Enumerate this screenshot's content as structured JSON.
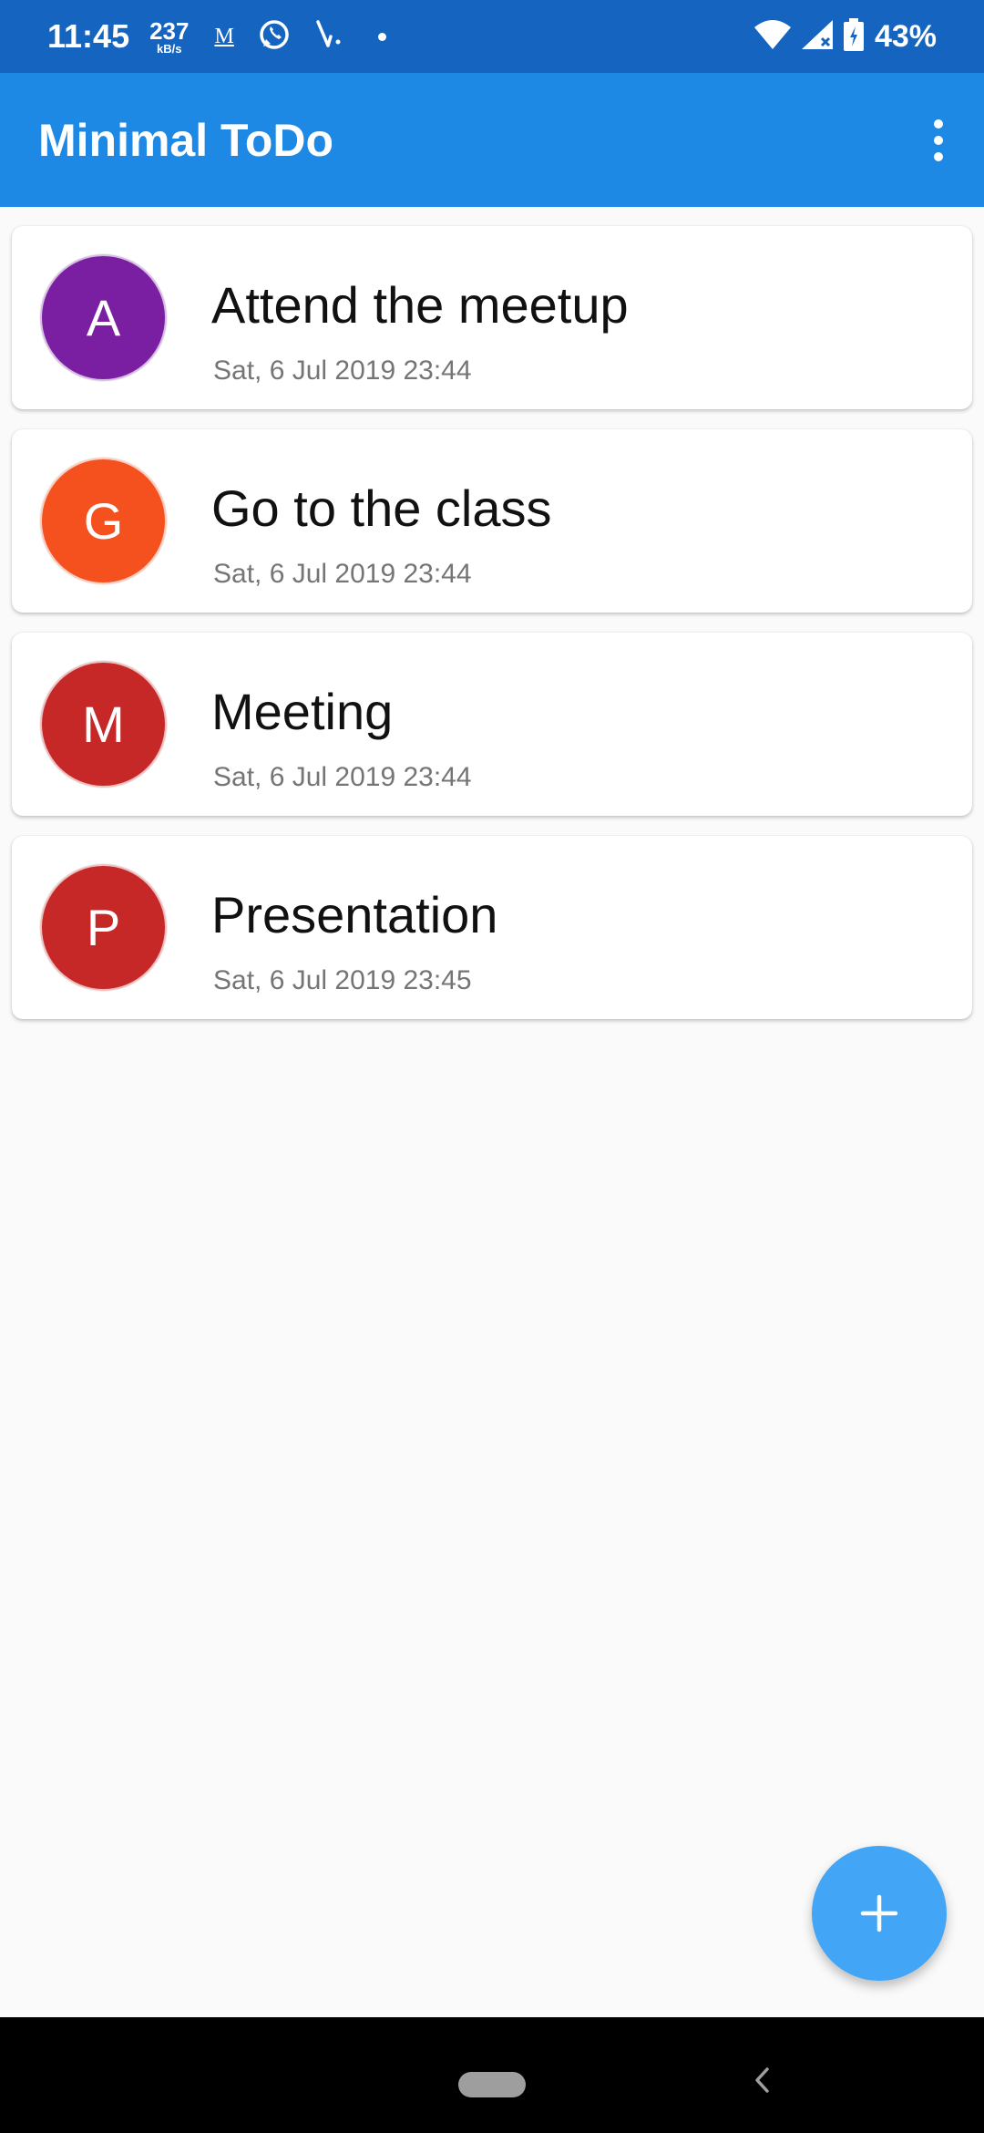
{
  "status_bar": {
    "time": "11:45",
    "net_speed_value": "237",
    "net_speed_unit": "kB/s",
    "gmail_icon": "M",
    "battery_percent": "43%",
    "icons": [
      "gmail-icon",
      "whatsapp-icon",
      "vpn-icon",
      "notification-dot-icon",
      "wifi-icon",
      "signal-icon",
      "battery-icon"
    ]
  },
  "app_bar": {
    "title": "Minimal ToDo",
    "menu_icon": "more-vert-icon",
    "color": "#1e88e5"
  },
  "todos": [
    {
      "letter": "A",
      "title": "Attend the meetup",
      "date": "Sat, 6 Jul 2019 23:44",
      "color": "#7b1fa2"
    },
    {
      "letter": "G",
      "title": "Go to the class",
      "date": "Sat, 6 Jul 2019 23:44",
      "color": "#f4511e"
    },
    {
      "letter": "M",
      "title": "Meeting",
      "date": "Sat, 6 Jul 2019 23:44",
      "color": "#c62828"
    },
    {
      "letter": "P",
      "title": "Presentation",
      "date": "Sat, 6 Jul 2019 23:45",
      "color": "#c62828"
    }
  ],
  "fab": {
    "icon": "add-icon",
    "color": "#42a5f5"
  },
  "nav_bar": {
    "home_icon": "home-pill-icon",
    "back_icon": "back-chevron-icon"
  }
}
